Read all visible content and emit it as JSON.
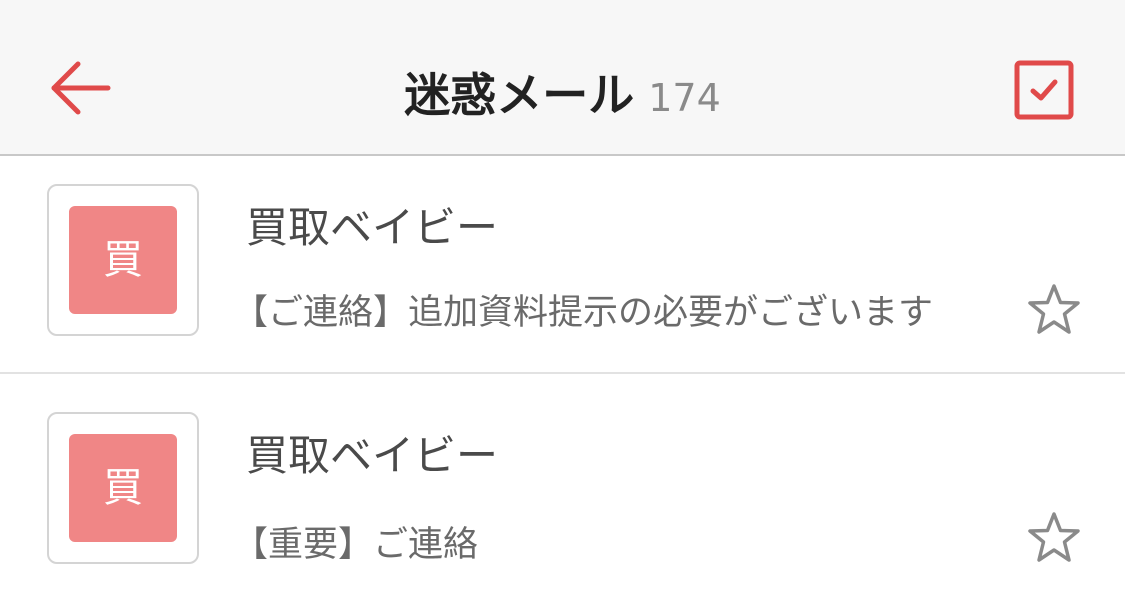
{
  "header": {
    "title": "迷惑メール",
    "count": "174",
    "back_icon": "arrow-left-icon",
    "select_icon": "checkbox-checked-icon",
    "accent_color": "#e04a4a"
  },
  "mails": [
    {
      "avatar_char": "買",
      "sender": "買取ベイビー",
      "subject": "【ご連絡】追加資料提示の必要がございます",
      "starred": false
    },
    {
      "avatar_char": "買",
      "sender": "買取ベイビー",
      "subject": "【重要】ご連絡",
      "starred": false
    }
  ],
  "colors": {
    "avatar_bg": "#f08686",
    "header_bg": "#f7f7f7",
    "star_outline": "#8a8a8a"
  }
}
